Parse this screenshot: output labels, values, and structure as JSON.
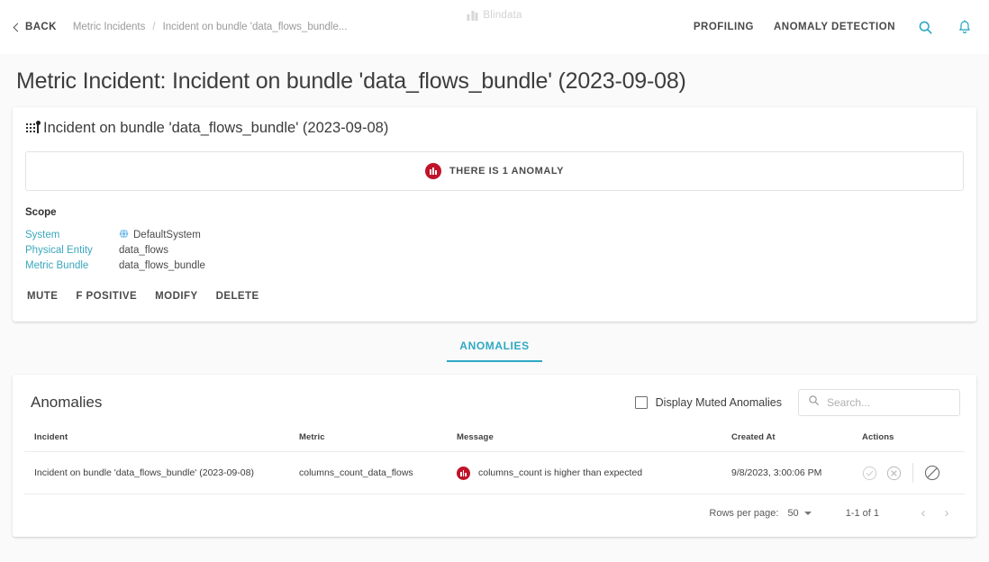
{
  "topbar": {
    "back_label": "BACK",
    "breadcrumbs": [
      {
        "label": "Metric Incidents"
      },
      {
        "label": "Incident on bundle 'data_flows_bundle..."
      }
    ],
    "breadcrumb_separator": "/",
    "brand_name": "Blindata",
    "nav": [
      {
        "label": "PROFILING"
      },
      {
        "label": "ANOMALY DETECTION"
      }
    ],
    "search_icon": "search-icon",
    "notifications_icon": "bell-icon",
    "accent_color": "#2fa8c4"
  },
  "page": {
    "title": "Metric Incident: Incident on bundle 'data_flows_bundle' (2023-09-08)"
  },
  "incident_card": {
    "icon": "metric-bundle-grid-icon",
    "title": "Incident on bundle 'data_flows_bundle' (2023-09-08)",
    "banner": {
      "icon": "anomaly-alert-icon",
      "text": "THERE IS 1 ANOMALY",
      "color": "#c0132a"
    },
    "scope_label": "Scope",
    "scope": [
      {
        "key": "System",
        "value": "DefaultSystem",
        "icon": "system-globe-icon"
      },
      {
        "key": "Physical Entity",
        "value": "data_flows",
        "icon": ""
      },
      {
        "key": "Metric Bundle",
        "value": "data_flows_bundle",
        "icon": ""
      }
    ],
    "actions": [
      {
        "label": "MUTE"
      },
      {
        "label": "F POSITIVE"
      },
      {
        "label": "MODIFY"
      },
      {
        "label": "DELETE"
      }
    ]
  },
  "tabs": [
    {
      "label": "ANOMALIES",
      "active": true
    }
  ],
  "anomalies_card": {
    "title": "Anomalies",
    "display_muted": {
      "label": "Display Muted Anomalies",
      "checked": false
    },
    "search": {
      "placeholder": "Search...",
      "value": "",
      "icon": "search-icon"
    },
    "columns": [
      "Incident",
      "Metric",
      "Message",
      "Created At",
      "Actions"
    ],
    "rows": [
      {
        "incident": "Incident on bundle 'data_flows_bundle' (2023-09-08)",
        "metric": "columns_count_data_flows",
        "message": "columns_count is higher than expected",
        "message_icon": "anomaly-alert-icon",
        "created_at": "9/8/2023, 3:00:06 PM",
        "actions": [
          "confirm-check-icon",
          "dismiss-x-icon",
          "mute-ban-icon"
        ]
      }
    ],
    "pagination": {
      "rows_per_page_label": "Rows per page:",
      "rows_per_page_value": "50",
      "range": "1-1 of 1",
      "prev_icon": "chevron-left-icon",
      "next_icon": "chevron-right-icon"
    }
  }
}
